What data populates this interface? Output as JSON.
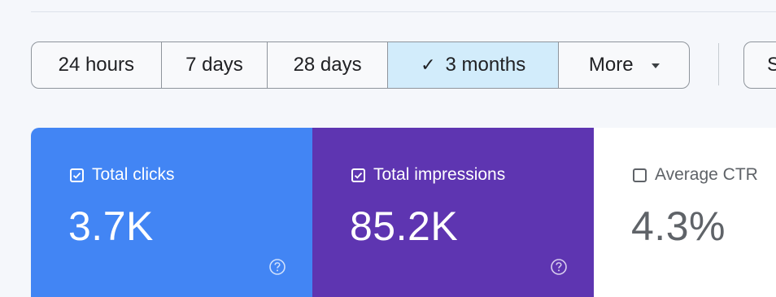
{
  "date_range": {
    "options": [
      {
        "label": "24 hours",
        "selected": false
      },
      {
        "label": "7 days",
        "selected": false
      },
      {
        "label": "28 days",
        "selected": false
      },
      {
        "label": "3 months",
        "selected": true
      },
      {
        "label": "More",
        "selected": false
      }
    ],
    "extra_button_label": "S"
  },
  "metrics": {
    "clicks": {
      "label": "Total clicks",
      "value": "3.7K",
      "checked": true
    },
    "impressions": {
      "label": "Total impressions",
      "value": "85.2K",
      "checked": true
    },
    "ctr": {
      "label": "Average CTR",
      "value": "4.3%",
      "checked": false
    }
  },
  "colors": {
    "clicks_card": "#4285f4",
    "impressions_card": "#5e35b1",
    "active_range": "#d2ecfb"
  },
  "icons": {
    "checked": "checkbox-checked-icon",
    "unchecked": "checkbox-empty-icon",
    "help": "help-circle-icon",
    "selected": "check-icon",
    "dropdown": "chevron-down-icon"
  }
}
